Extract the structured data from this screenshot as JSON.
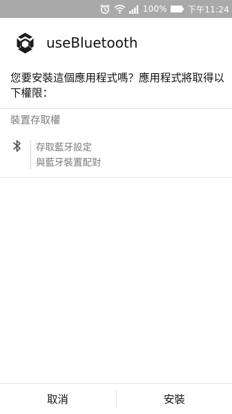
{
  "status_bar": {
    "battery_percent": "100%",
    "time": "下午11:24",
    "icons": [
      "alarm-icon",
      "wifi-icon",
      "signal-icon",
      "battery-icon"
    ]
  },
  "header": {
    "app_name": "useBluetooth",
    "app_icon": "unity-logo-icon"
  },
  "prompt": {
    "text": "您要安裝這個應用程式嗎？應用程式將取得以下權限："
  },
  "permissions": {
    "section_title": "裝置存取權",
    "items": [
      {
        "icon": "bluetooth-icon",
        "line1": "存取藍牙設定",
        "line2": "與藍牙裝置配對"
      }
    ]
  },
  "buttons": {
    "cancel_label": "取消",
    "install_label": "安裝"
  },
  "colors": {
    "status_bar_bg": "#a9a9a9",
    "text_primary": "#111111",
    "text_secondary": "#7a7a7a",
    "divider": "#e2e2e2"
  }
}
